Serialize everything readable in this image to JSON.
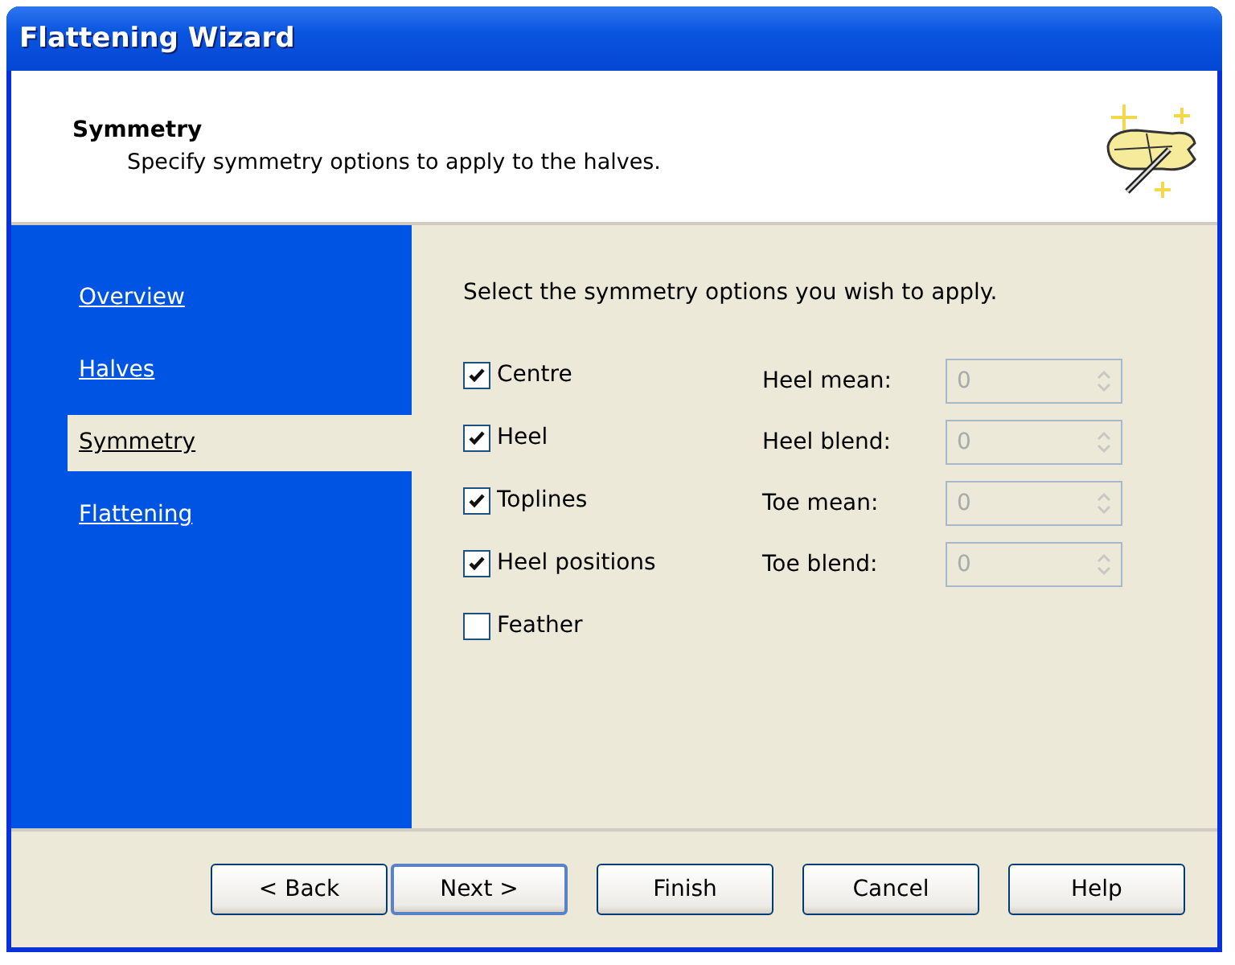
{
  "window": {
    "title": "Flattening Wizard"
  },
  "header": {
    "title": "Symmetry",
    "subtitle": "Specify symmetry options to apply to the halves."
  },
  "steps": [
    {
      "label": "Overview",
      "selected": false
    },
    {
      "label": "Halves",
      "selected": false
    },
    {
      "label": "Symmetry",
      "selected": true
    },
    {
      "label": "Flattening",
      "selected": false
    }
  ],
  "instruction": "Select the symmetry options you wish to apply.",
  "options": [
    {
      "label": "Centre",
      "checked": true
    },
    {
      "label": "Heel",
      "checked": true
    },
    {
      "label": "Toplines",
      "checked": true
    },
    {
      "label": "Heel positions",
      "checked": true
    },
    {
      "label": "Feather",
      "checked": false
    }
  ],
  "fields": [
    {
      "label": "Heel mean:",
      "value": "0",
      "disabled": true
    },
    {
      "label": "Heel blend:",
      "value": "0",
      "disabled": true
    },
    {
      "label": "Toe mean:",
      "value": "0",
      "disabled": true
    },
    {
      "label": "Toe blend:",
      "value": "0",
      "disabled": true
    }
  ],
  "buttons": [
    {
      "label": "< Back",
      "default": false
    },
    {
      "label": "Next >",
      "default": true
    },
    {
      "label": "Finish",
      "default": false
    },
    {
      "label": "Cancel",
      "default": false
    },
    {
      "label": "Help",
      "default": false
    }
  ]
}
